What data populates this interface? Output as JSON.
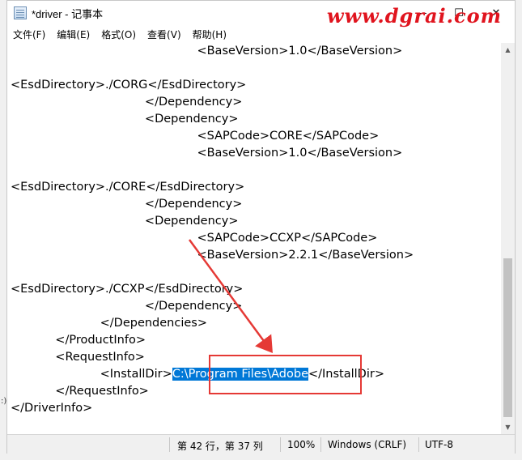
{
  "window": {
    "title": "*driver - 记事本",
    "controls": {
      "minimize": "—",
      "maximize": "☐",
      "close": "✕"
    },
    "watermark": "www.dgrai.com"
  },
  "menu": [
    "文件(F)",
    "编辑(E)",
    "格式(O)",
    "查看(V)",
    "帮助(H)"
  ],
  "editor": {
    "lines": [
      "                                                  <BaseVersion>1.0</BaseVersion>",
      "",
      "<EsdDirectory>./CORG</EsdDirectory>",
      "                                    </Dependency>",
      "                                    <Dependency>",
      "                                                  <SAPCode>CORE</SAPCode>",
      "                                                  <BaseVersion>1.0</BaseVersion>",
      "",
      "<EsdDirectory>./CORE</EsdDirectory>",
      "                                    </Dependency>",
      "                                    <Dependency>",
      "                                                  <SAPCode>CCXP</SAPCode>",
      "                                                  <BaseVersion>2.2.1</BaseVersion>",
      "",
      "<EsdDirectory>./CCXP</EsdDirectory>",
      "                                    </Dependency>",
      "                        </Dependencies>",
      "            </ProductInfo>",
      "            <RequestInfo>",
      "",
      "            </RequestInfo>",
      "</DriverInfo>"
    ],
    "installdir_line": {
      "prefix": "                        <InstallDir>",
      "selected": "C:\\Program Files\\Adobe",
      "suffix": "</InstallDir>"
    }
  },
  "status": {
    "position": "第 42 行，第 37 列",
    "zoom": "100%",
    "line_ending": "Windows (CRLF)",
    "encoding": "UTF-8"
  },
  "colors": {
    "selection": "#0078d7",
    "annotation": "#e53935",
    "watermark": "#e0141e"
  }
}
